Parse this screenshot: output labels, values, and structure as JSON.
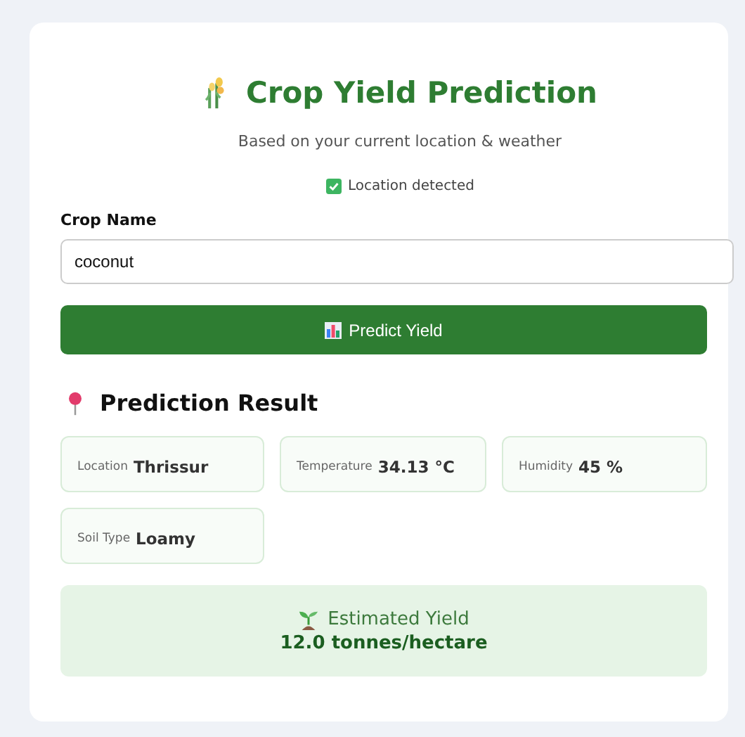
{
  "header": {
    "title": "Crop Yield Prediction",
    "subtitle": "Based on your current location & weather",
    "status": "Location detected"
  },
  "form": {
    "label": "Crop Name",
    "value": "coconut",
    "button": "Predict Yield"
  },
  "result": {
    "heading": "Prediction Result",
    "stats": [
      {
        "label": "Location",
        "value": "Thrissur"
      },
      {
        "label": "Temperature",
        "value": "34.13 °C"
      },
      {
        "label": "Humidity",
        "value": "45 %"
      },
      {
        "label": "Soil Type",
        "value": "Loamy"
      }
    ],
    "yield_label": "Estimated Yield",
    "yield_value": "12.0 tonnes/hectare"
  }
}
